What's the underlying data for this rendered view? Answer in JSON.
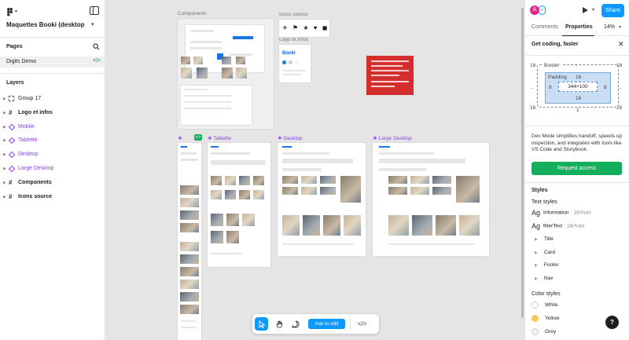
{
  "left_panel": {
    "file_title": "Maquettes Booki (desktop,...",
    "pages_label": "Pages",
    "pages": [
      {
        "label": "Digits Demo"
      }
    ],
    "layers_label": "Layers",
    "layers": [
      {
        "label": "Group 17",
        "type": "group"
      },
      {
        "label": "Logo et infos",
        "type": "frame"
      },
      {
        "label": "Mobile",
        "type": "component"
      },
      {
        "label": "Tablette",
        "type": "component"
      },
      {
        "label": "Desktop",
        "type": "component"
      },
      {
        "label": "Large Desktop",
        "type": "component"
      },
      {
        "label": "Components",
        "type": "frame"
      },
      {
        "label": "Icons source",
        "type": "frame"
      }
    ]
  },
  "canvas": {
    "labels": {
      "components": "Components",
      "icons_source": "Icons source",
      "logo_infos": "Logo et infos",
      "tablette": "Tablette",
      "desktop": "Desktop",
      "large_desktop": "Large Desktop"
    },
    "logo_text": "Booki"
  },
  "toolbar": {
    "ask_label": "Ask to edit"
  },
  "right_panel": {
    "avatar_initial": "A",
    "share_label": "Share",
    "tabs": [
      {
        "label": "Comments"
      },
      {
        "label": "Properties"
      }
    ],
    "zoom": "14%",
    "promo_title": "Get coding, faster",
    "box_model": {
      "border_label": "Border",
      "border_value": "-",
      "padding_label": "Padding",
      "outer_top": "16",
      "outer_bottom": "16",
      "outer_left": "16",
      "outer_right": "16",
      "pad_top": "16",
      "pad_bottom": "16",
      "pad_left": "8",
      "pad_right": "8",
      "side_left": "-",
      "side_right": "-",
      "content": "344×100",
      "below": "1"
    },
    "dev_text": "Dev Mode simplifies handoff, speeds up inspection, and integrates with tools like VS Code and Storybook.",
    "request_label": "Request access",
    "styles_label": "Styles",
    "text_styles_label": "Text styles",
    "text_styles": [
      {
        "ag": "Ag",
        "name": "Information",
        "meta": " · 16/Auto"
      },
      {
        "ag": "Ag",
        "name": "filterText",
        "meta": " · 18/Auto"
      }
    ],
    "sub_styles": [
      {
        "label": "Title"
      },
      {
        "label": "Card"
      },
      {
        "label": "Footer"
      },
      {
        "label": "Nav"
      }
    ],
    "color_styles_label": "Color styles",
    "colors": [
      {
        "name": "White",
        "hex": "#ffffff"
      },
      {
        "name": "Yellow",
        "hex": "#f5c85a"
      },
      {
        "name": "Grey",
        "hex": "#f2f2f2"
      }
    ],
    "help_label": "?"
  }
}
